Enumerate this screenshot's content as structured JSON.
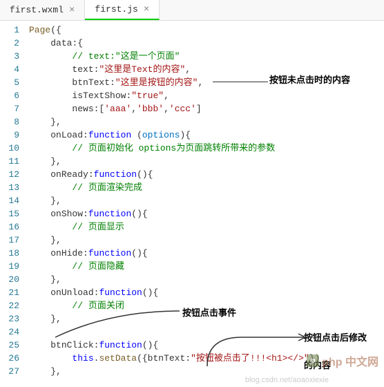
{
  "tabs": [
    {
      "label": "first.wxml"
    },
    {
      "label": "first.js"
    }
  ],
  "lines": [
    {
      "n": "1",
      "html": "<span class='fn'>Page</span>({"
    },
    {
      "n": "2",
      "html": "    <span class='prop'>data</span>:{"
    },
    {
      "n": "3",
      "html": "        <span class='cm'>// text:\"这是一个页面\"</span>"
    },
    {
      "n": "4",
      "html": "        <span class='prop'>text</span>:<span class='str'>\"这里是Text的内容\"</span>,"
    },
    {
      "n": "5",
      "html": "        <span class='prop'>btnText</span>:<span class='str'>\"这里是按钮的内容\"</span>,"
    },
    {
      "n": "6",
      "html": "        <span class='prop'>isTextShow</span>:<span class='str'>\"true\"</span>,"
    },
    {
      "n": "7",
      "html": "        <span class='prop'>news</span>:[<span class='str'>'aaa'</span>,<span class='str'>'bbb'</span>,<span class='str'>'ccc'</span>]"
    },
    {
      "n": "8",
      "html": "    },"
    },
    {
      "n": "9",
      "html": "    <span class='prop'>onLoad</span>:<span class='kw'>function</span> (<span class='fnblue'>options</span>){"
    },
    {
      "n": "10",
      "html": "        <span class='cm'>// 页面初始化 options为页面跳转所带来的参数</span>"
    },
    {
      "n": "11",
      "html": "    },"
    },
    {
      "n": "12",
      "html": "    <span class='prop'>onReady</span>:<span class='kw'>function</span>(){"
    },
    {
      "n": "13",
      "html": "        <span class='cm'>// 页面渲染完成</span>"
    },
    {
      "n": "14",
      "html": "    },"
    },
    {
      "n": "15",
      "html": "    <span class='prop'>onShow</span>:<span class='kw'>function</span>(){"
    },
    {
      "n": "16",
      "html": "        <span class='cm'>// 页面显示</span>"
    },
    {
      "n": "17",
      "html": "    },"
    },
    {
      "n": "18",
      "html": "    <span class='prop'>onHide</span>:<span class='kw'>function</span>(){"
    },
    {
      "n": "19",
      "html": "        <span class='cm'>// 页面隐藏</span>"
    },
    {
      "n": "20",
      "html": "    },"
    },
    {
      "n": "21",
      "html": "    <span class='prop'>onUnload</span>:<span class='kw'>function</span>(){"
    },
    {
      "n": "22",
      "html": "        <span class='cm'>// 页面关闭</span>"
    },
    {
      "n": "23",
      "html": "    },"
    },
    {
      "n": "24",
      "html": ""
    },
    {
      "n": "25",
      "html": "    <span class='prop'>btnClick</span>:<span class='kw'>function</span>(){"
    },
    {
      "n": "26",
      "html": "        <span class='kw'>this</span>.<span class='fn'>setData</span>({<span class='prop'>btnText</span>:<span class='str'>\"按钮被点击了!!!&lt;h1&gt;&lt;/&gt;\"</span>})"
    },
    {
      "n": "27",
      "html": "    },"
    }
  ],
  "annotations": {
    "a1": "按钮未点击时的内容",
    "a2": "按钮点击事件",
    "a3": "按钮点击后修改",
    "a4": "的内容",
    "watermark1": "php 中文网",
    "watermark2": "blog.csdn.net/aoaoxiexie"
  }
}
